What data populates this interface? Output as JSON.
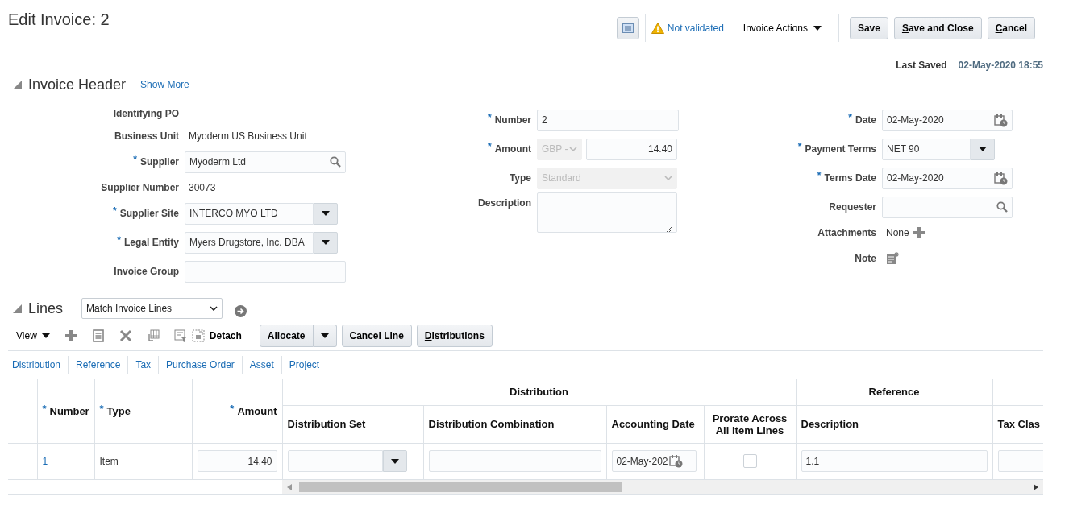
{
  "page": {
    "title": "Edit Invoice: 2"
  },
  "toolbar": {
    "status": "Not validated",
    "actions_menu": "Invoice Actions",
    "buttons": [
      {
        "label": "Save",
        "mnemonic": false
      },
      {
        "label": "Save and Close",
        "mnemonic": true
      },
      {
        "label": "Cancel",
        "mnemonic": true
      }
    ]
  },
  "last_saved": {
    "label": "Last Saved",
    "value": "02-May-2020 18:55"
  },
  "invoice_header": {
    "title": "Invoice Header",
    "expanded": true,
    "show_more": "Show More",
    "columns": [
      {
        "fields": [
          {
            "label": "Identifying PO",
            "kind": "static"
          },
          {
            "label": "Business Unit",
            "kind": "static",
            "value": "Myoderm US Business Unit"
          },
          {
            "label": "Supplier",
            "required_mark": "*",
            "kind": "search",
            "value": "Myoderm Ltd"
          },
          {
            "label": "Supplier Number",
            "kind": "static",
            "value": "30073"
          },
          {
            "label": "Supplier Site",
            "required_mark": "*",
            "kind": "choice",
            "value": "INTERCO MYO LTD"
          },
          {
            "label": "Legal Entity",
            "required_mark": "*",
            "kind": "choice",
            "value": "Myers Drugstore, Inc. DBA"
          },
          {
            "label": "Invoice Group",
            "kind": "text"
          }
        ]
      },
      {
        "fields": [
          {
            "label": "Number",
            "required_mark": "*",
            "kind": "text",
            "value": "2"
          },
          {
            "label": "Amount",
            "required_mark": "*",
            "kind": "currency-amount",
            "currency": "GBP -",
            "currency_disabled": true,
            "value": "14.40"
          },
          {
            "label": "Type",
            "kind": "select",
            "value": "Standard",
            "disabled": true
          },
          {
            "label": "Description",
            "kind": "textarea"
          }
        ]
      },
      {
        "fields": [
          {
            "label": "Date",
            "required_mark": "*",
            "kind": "date",
            "value": "02-May-2020"
          },
          {
            "label": "Payment Terms",
            "required_mark": "*",
            "kind": "choice",
            "value": "NET 90"
          },
          {
            "label": "Terms Date",
            "required_mark": "*",
            "kind": "date",
            "value": "02-May-2020"
          },
          {
            "label": "Requester",
            "kind": "search"
          },
          {
            "label": "Attachments",
            "kind": "attachments",
            "value": "None"
          },
          {
            "label": "Note",
            "kind": "note"
          }
        ]
      }
    ]
  },
  "lines": {
    "title": "Lines",
    "expanded": true,
    "match_select": "Match Invoice Lines",
    "view_menu": "View",
    "detach": "Detach",
    "buttons": [
      {
        "label": "Allocate",
        "kind": "split",
        "mnemonic": false
      },
      {
        "label": "Cancel Line",
        "kind": "plain",
        "mnemonic": false
      },
      {
        "label": "Distributions",
        "kind": "plain",
        "mnemonic": true
      }
    ],
    "links": [
      "Distribution",
      "Reference",
      "Tax",
      "Purchase Order",
      "Asset",
      "Project"
    ],
    "table": {
      "columns": [
        {
          "label": "Number",
          "required_mark": "*"
        },
        {
          "label": "Type",
          "required_mark": "*"
        },
        {
          "label": "Amount",
          "required_mark": "*"
        }
      ],
      "column_groups": [
        {
          "label": "Distribution",
          "columns": [
            {
              "label": "Distribution Set"
            },
            {
              "label": "Distribution Combination"
            },
            {
              "label": "Accounting Date"
            },
            {
              "label": "Prorate Across All Item Lines"
            }
          ]
        },
        {
          "label": "Reference",
          "columns": [
            {
              "label": "Description"
            }
          ]
        },
        {
          "columns": [
            {
              "label": "Tax Clas"
            }
          ]
        }
      ],
      "rows": [
        {
          "cells": [
            {
              "kind": "link",
              "value": "1"
            },
            {
              "kind": "text",
              "value": "Item"
            },
            {
              "kind": "amount",
              "value": "14.40"
            },
            {
              "kind": "choice"
            },
            {
              "kind": "input"
            },
            {
              "kind": "date",
              "value": "02-May-202"
            },
            {
              "kind": "checkbox",
              "checked": false
            },
            {
              "kind": "input",
              "value": "1.1"
            },
            {
              "kind": "input"
            }
          ]
        }
      ]
    }
  }
}
